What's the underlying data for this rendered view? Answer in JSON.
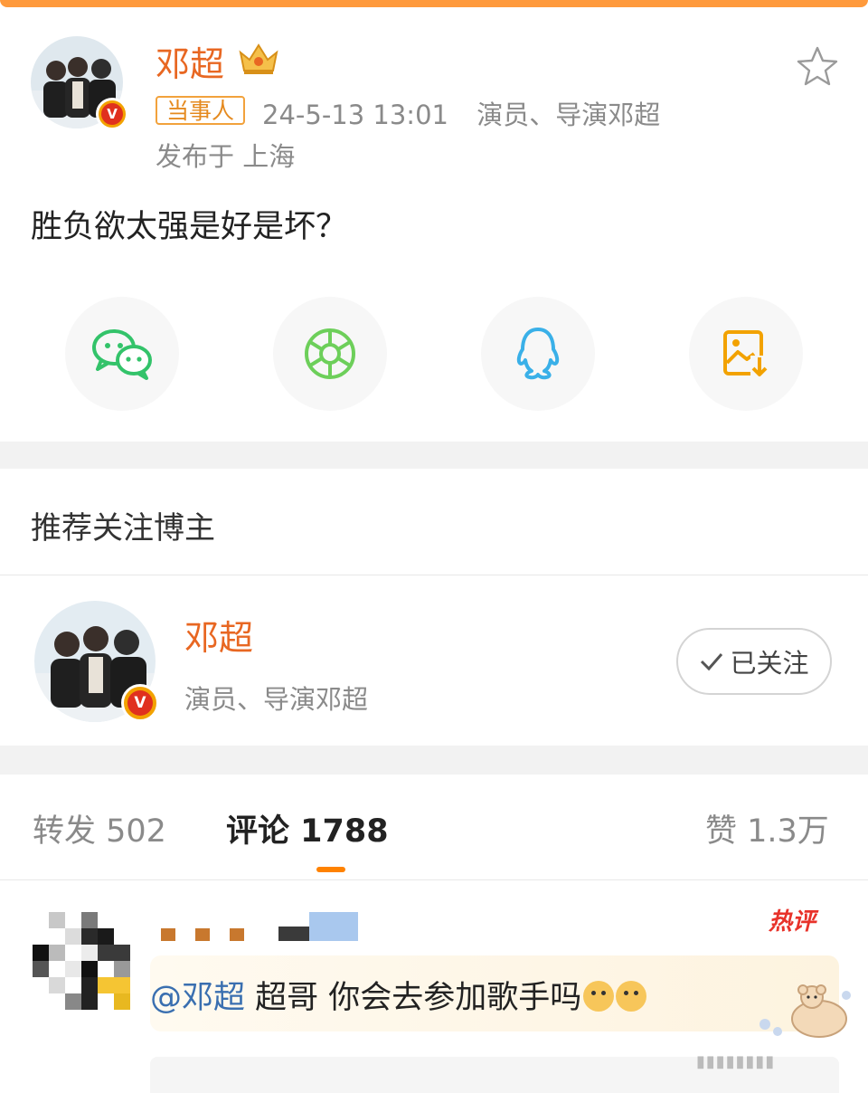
{
  "post": {
    "username": "邓超",
    "tag": "当事人",
    "time": "24-5-13 13:01",
    "verified_title": "演员、导演邓超",
    "location": "发布于 上海",
    "text": "胜负欲太强是好是坏？"
  },
  "share": {
    "items": [
      {
        "icon": "wechat-icon",
        "color": "#33c36a"
      },
      {
        "icon": "moments-icon",
        "color": "#6dcf5a"
      },
      {
        "icon": "qq-icon",
        "color": "#3ab0e8"
      },
      {
        "icon": "save-image-icon",
        "color": "#f2a200"
      }
    ]
  },
  "recommend": {
    "title": "推荐关注博主",
    "name": "邓超",
    "desc": "演员、导演邓超",
    "follow_label": "已关注"
  },
  "tabs": {
    "repost": "转发 502",
    "comment": "评论 1788",
    "like": "赞 1.3万"
  },
  "comment": {
    "hot_label": "热评",
    "mention": "@邓超",
    "text": " 超哥 你会去参加歌手吗"
  },
  "colors": {
    "accent": "#ff8200",
    "username": "#e86722",
    "mention": "#3a6fb0",
    "hot": "#e8322a"
  }
}
